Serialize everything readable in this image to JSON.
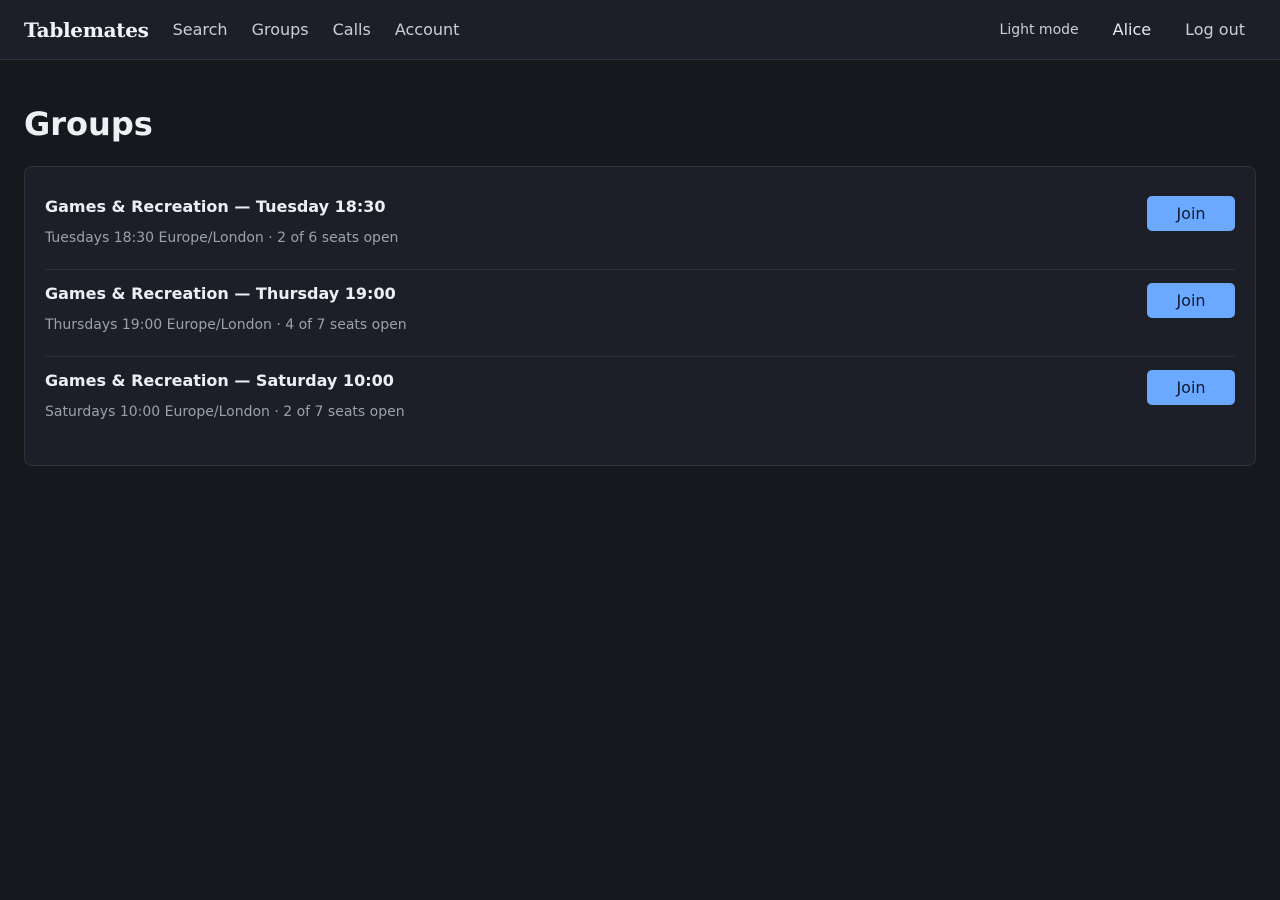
{
  "app": {
    "brand": "Tablemates",
    "nav": [
      "Search",
      "Groups",
      "Calls",
      "Account"
    ],
    "theme_toggle": "Light mode",
    "user": "Alice",
    "logout": "Log out"
  },
  "page": {
    "title": "Groups"
  },
  "groups": [
    {
      "title": "Games & Recreation — Tuesday 18:30",
      "meta": "Tuesdays 18:30 Europe/London · 2 of 6 seats open",
      "action": "Join"
    },
    {
      "title": "Games & Recreation — Thursday 19:00",
      "meta": "Thursdays 19:00 Europe/London · 4 of 7 seats open",
      "action": "Join"
    },
    {
      "title": "Games & Recreation — Saturday 10:00",
      "meta": "Saturdays 10:00 Europe/London · 2 of 7 seats open",
      "action": "Join"
    }
  ],
  "colors": {
    "accent": "#6ba8ff",
    "background": "#17181d",
    "surface": "#1c1f27"
  }
}
